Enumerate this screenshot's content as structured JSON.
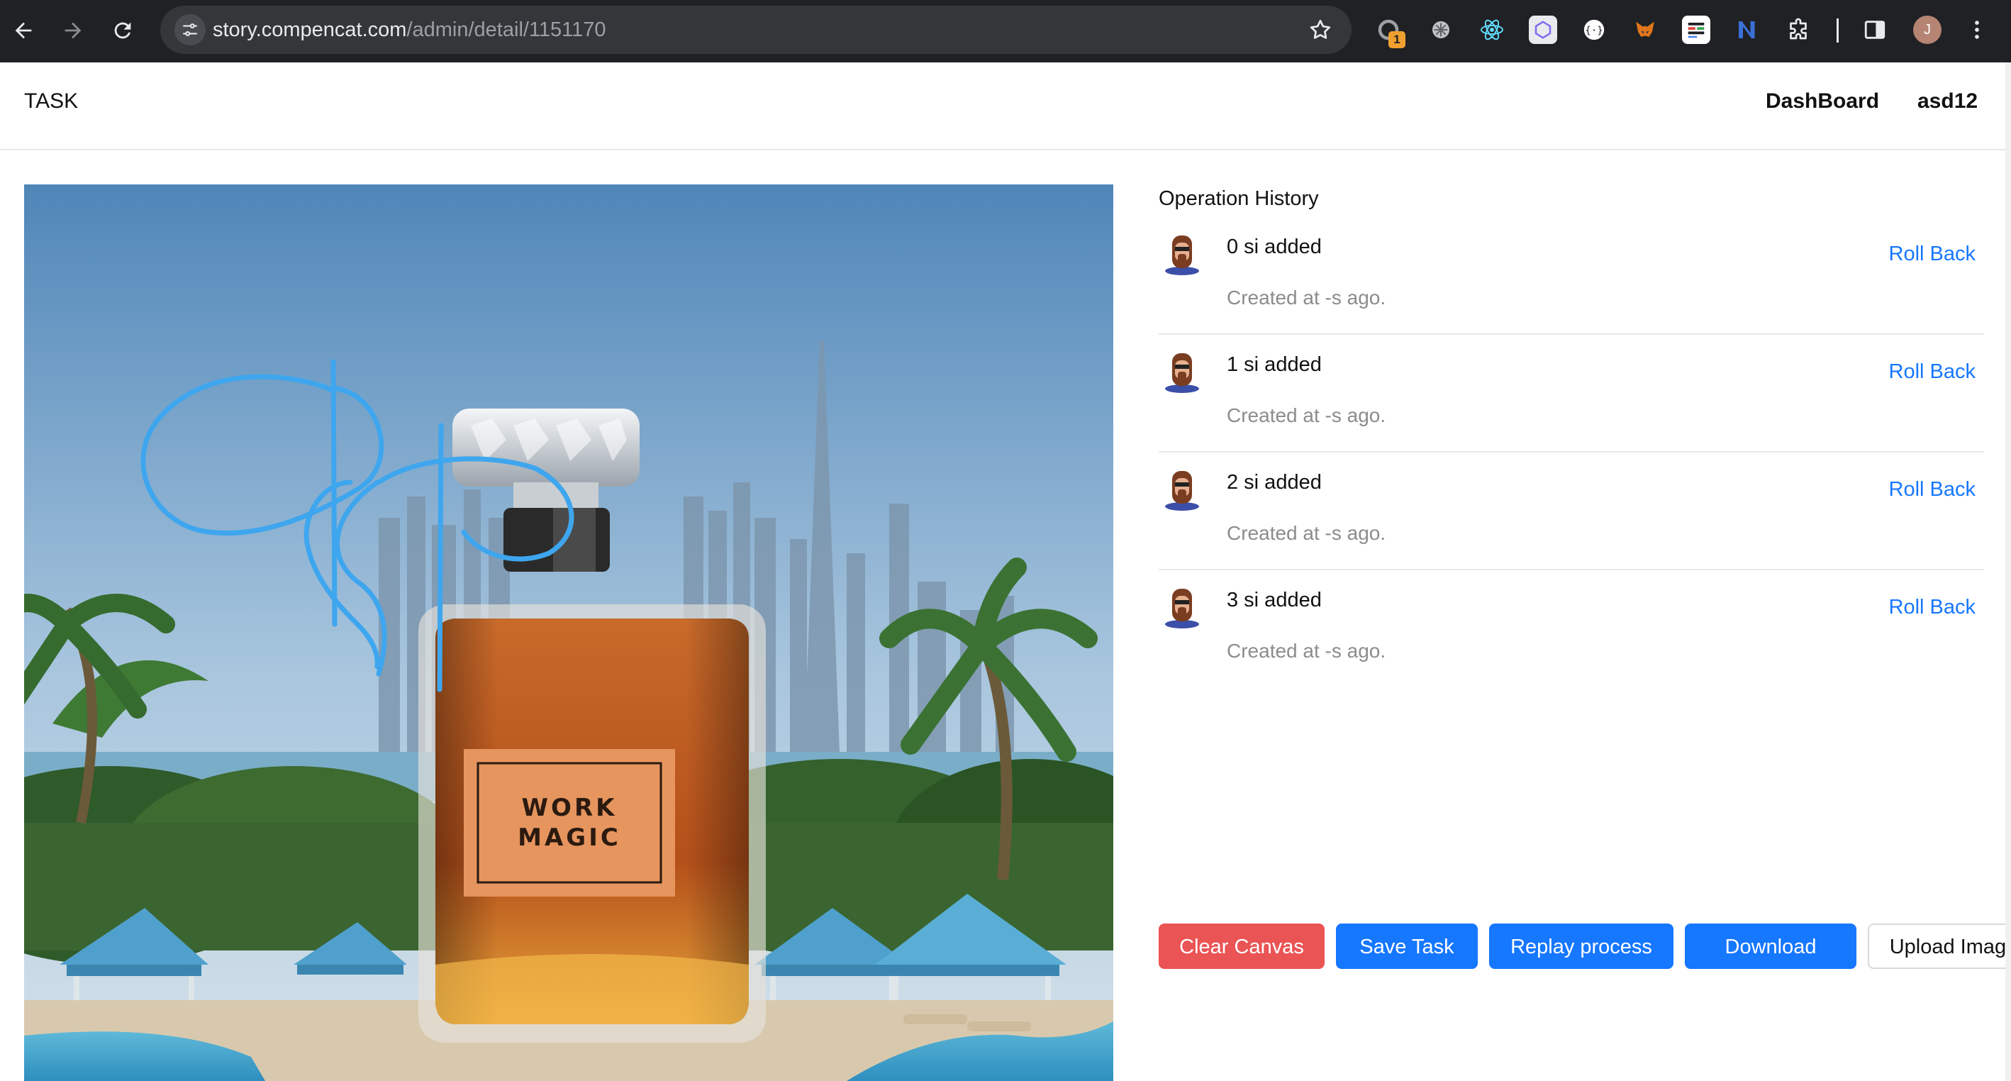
{
  "browser": {
    "url_host": "story.compencat.com",
    "url_path": "/admin/detail/1151170",
    "extension_badge": "1",
    "profile_initial": "J",
    "icons": [
      "back-arrow-icon",
      "forward-arrow-icon",
      "reload-icon",
      "site-info-icon",
      "bookmark-star-icon",
      "extensions-puzzle-icon",
      "side-panel-icon",
      "kebab-menu-icon"
    ]
  },
  "header": {
    "brand": "TASK",
    "nav": {
      "dashboard": "DashBoard",
      "user": "asd12"
    }
  },
  "canvas": {
    "label_line1": "WORK",
    "label_line2": "MAGIC",
    "stroke_color": "#3ea6ee"
  },
  "history": {
    "title": "Operation History",
    "items": [
      {
        "title": "0 si added",
        "time": "Created at -s ago.",
        "action": "Roll Back"
      },
      {
        "title": "1 si added",
        "time": "Created at -s ago.",
        "action": "Roll Back"
      },
      {
        "title": "2 si added",
        "time": "Created at -s ago.",
        "action": "Roll Back"
      },
      {
        "title": "3 si added",
        "time": "Created at -s ago.",
        "action": "Roll Back"
      }
    ]
  },
  "actions": {
    "clear": "Clear Canvas",
    "save": "Save Task",
    "replay": "Replay process",
    "download": "Download",
    "upload": "Upload Image"
  },
  "colors": {
    "primary": "#1677ff",
    "danger": "#ea5455",
    "chrome_bg": "#202124"
  }
}
